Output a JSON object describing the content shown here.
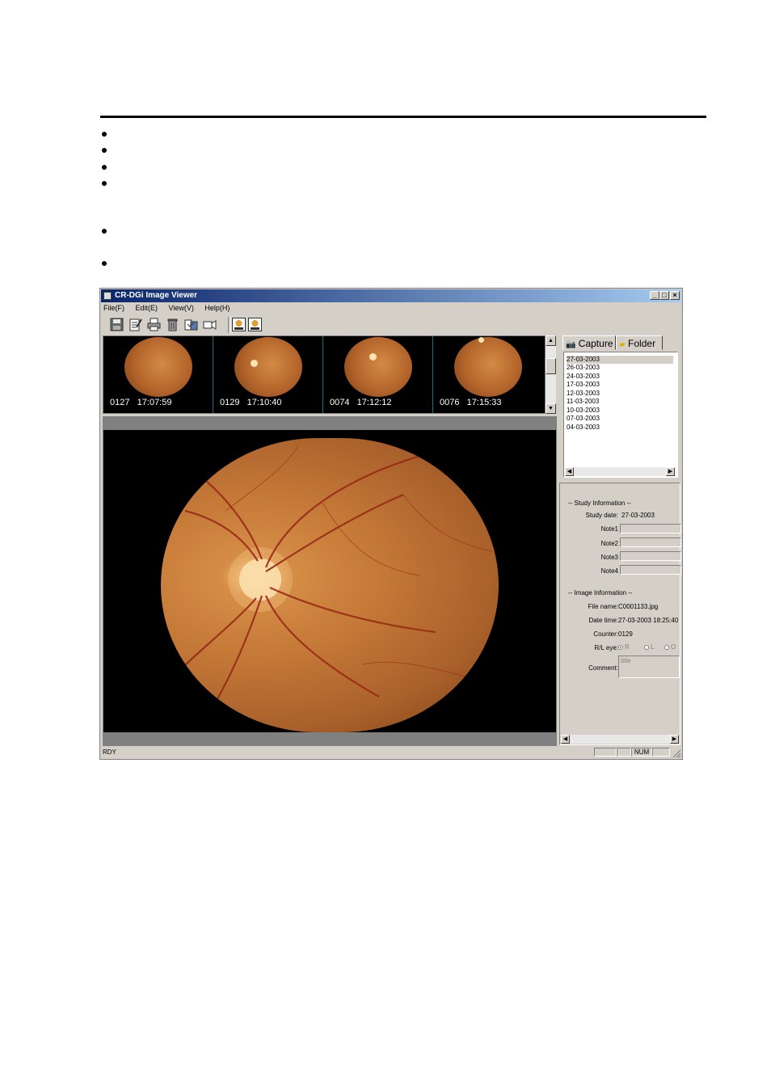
{
  "window": {
    "title": "CR-DGi Image Viewer",
    "controls": [
      "_",
      "□",
      "×"
    ]
  },
  "menu": [
    "File(F)",
    "Edit(E)",
    "View(V)",
    "Help(H)"
  ],
  "toolbar": {
    "icons": [
      "save-icon",
      "edit-icon",
      "print-icon",
      "delete-icon",
      "export-icon",
      "video-icon",
      "single-view-icon",
      "dual-view-icon"
    ]
  },
  "thumbnails": [
    {
      "counter": "0127",
      "time": "17:07:59"
    },
    {
      "counter": "0129",
      "time": "17:10:40"
    },
    {
      "counter": "0074",
      "time": "17:12:12"
    },
    {
      "counter": "0076",
      "time": "17:15:33"
    }
  ],
  "tabs": {
    "capture": "Capture",
    "folder": "Folder"
  },
  "folders": [
    "27-03-2003",
    "26-03-2003",
    "24-03-2003",
    "17-03-2003",
    "12-03-2003",
    "11-03-2003",
    "10-03-2003",
    "07-03-2003",
    "04-03-2003"
  ],
  "study": {
    "header": "-- Study Information --",
    "study_date_label": "Study date:",
    "study_date": "27-03-2003",
    "note_labels": [
      "Note1",
      "Note2",
      "Note3",
      "Note4"
    ]
  },
  "image": {
    "header": "-- Image Information --",
    "file_name_label": "File name:",
    "file_name": "C0001133.jpg",
    "date_time_label": "Date time:",
    "date_time": "27-03-2003 18:25:40",
    "counter_label": "Counter:",
    "counter": "0129",
    "eye_label": "R/L eye:",
    "eye_options": [
      "R",
      "L",
      "O"
    ],
    "comment_label": "Comment:",
    "comment": "title"
  },
  "status": {
    "left": "RDY",
    "num": "NUM"
  }
}
